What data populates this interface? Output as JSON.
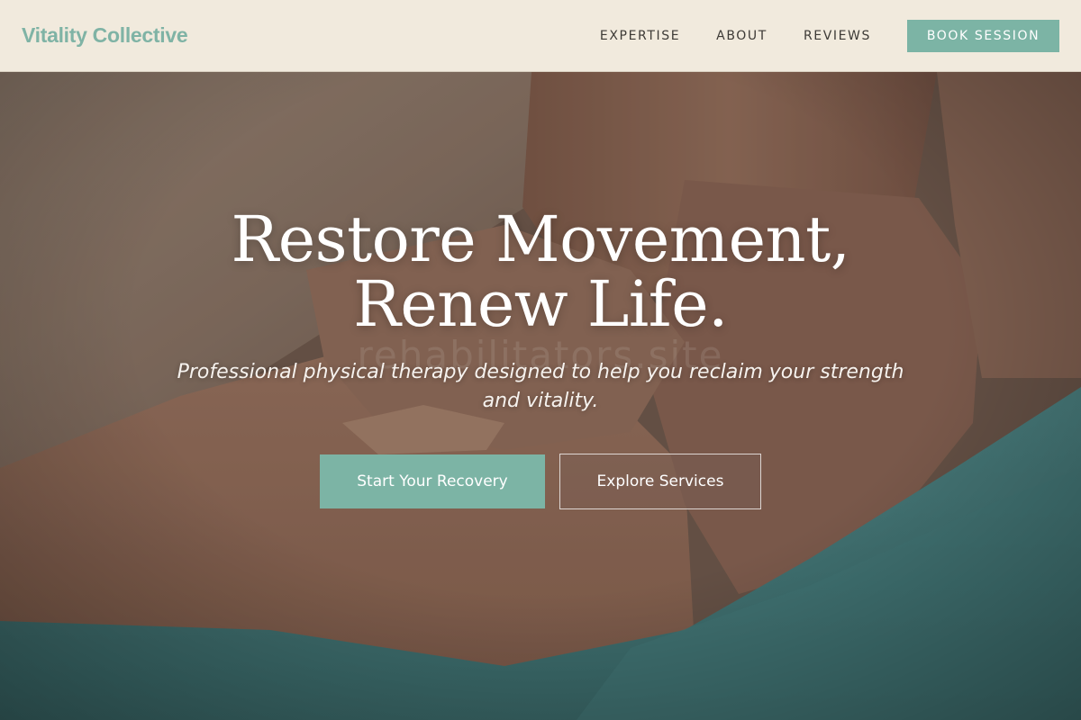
{
  "header": {
    "brand": "Vitality Collective",
    "nav": [
      {
        "label": "EXPERTISE"
      },
      {
        "label": "ABOUT"
      },
      {
        "label": "REVIEWS"
      }
    ],
    "cta_label": "BOOK SESSION"
  },
  "hero": {
    "headline_line1": "Restore Movement,",
    "headline_line2": "Renew Life.",
    "subtitle": "Professional physical therapy designed to help you reclaim your strength and vitality.",
    "watermark": "rehabilitators.site",
    "primary_cta": "Start Your Recovery",
    "secondary_cta": "Explore Services",
    "background_image": "therapist-hands-massaging-shoulder-photo"
  },
  "colors": {
    "accent": "#7cb4a5",
    "header_bg": "#f1eadd",
    "nav_text": "#3d3a36"
  }
}
